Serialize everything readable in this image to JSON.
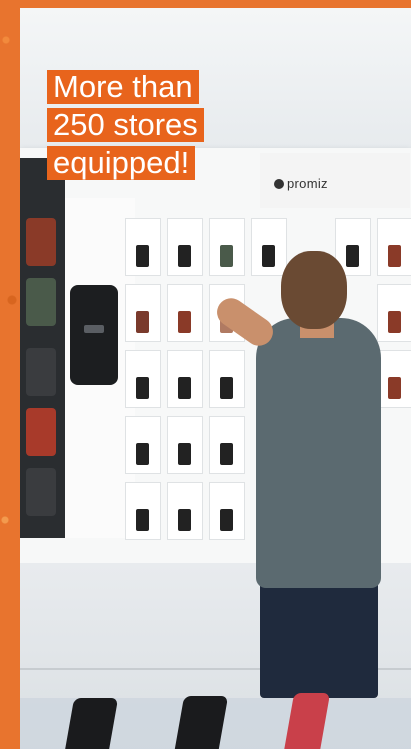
{
  "headline": {
    "line1": "More than",
    "line2": "250 stores",
    "line3": "equipped!"
  },
  "photo": {
    "brand_sign_text": "promiz"
  },
  "colors": {
    "accent": "#e8641c",
    "border": "#e8742e"
  }
}
